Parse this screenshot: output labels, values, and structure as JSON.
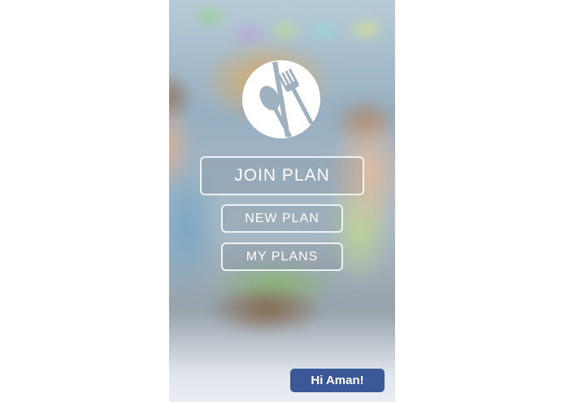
{
  "app": {
    "logo_icon": "plate-spoon-fork-icon"
  },
  "menu": {
    "join_label": "JOIN PLAN",
    "new_label": "NEW PLAN",
    "my_plans_label": "MY PLANS"
  },
  "greeting": {
    "text": "Hi Aman!",
    "color": "#3b5998"
  },
  "colors": {
    "button_border": "#ffffff",
    "button_text": "#ffffff"
  }
}
